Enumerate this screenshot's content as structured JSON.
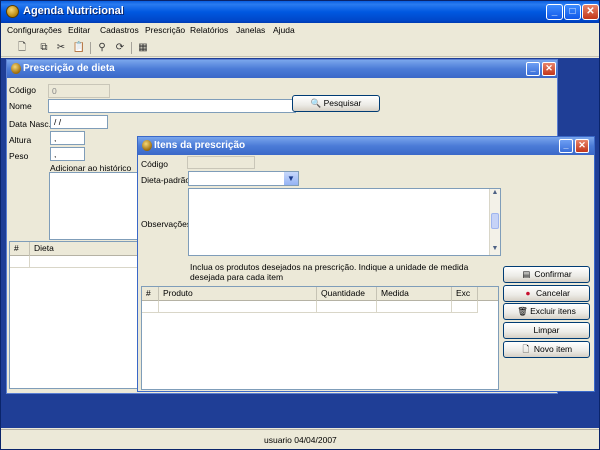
{
  "app": {
    "title": "Agenda Nutricional",
    "menu": [
      "Configurações",
      "Editar",
      "Cadastros",
      "Prescrição",
      "Relatórios",
      "Janelas",
      "Ajuda"
    ],
    "toolbar_icons": [
      "new-icon",
      "copy-icon",
      "cut-icon",
      "paste-icon",
      "find-icon",
      "refresh-icon",
      "calculator-icon"
    ],
    "status": "usuario  04/04/2007"
  },
  "prescricao": {
    "title": "Prescrição de dieta",
    "codigo_label": "Código",
    "codigo_value": "0",
    "nome_label": "Nome",
    "nome_value": "",
    "pesquisar_label": "Pesquisar",
    "data_nasc_label": "Data Nasc.",
    "data_nasc_value": " / /",
    "altura_label": "Altura",
    "altura_value": ",",
    "peso_label": "Peso",
    "peso_value": ",",
    "historico_label": "Adicionar ao histórico",
    "grid_headers": [
      "#",
      "Dieta"
    ]
  },
  "itens": {
    "title": "Itens da prescrição",
    "codigo_label": "Código",
    "dieta_padrao_label": "Dieta-padrão",
    "dieta_padrao_value": "",
    "observacoes_label": "Observações",
    "hint": "Inclua os produtos desejados na prescrição. Indique a unidade de medida desejada para cada item",
    "grid_headers": [
      "#",
      "Produto",
      "Quantidade",
      "Medida",
      "Exc"
    ],
    "buttons": {
      "confirmar": "Confirmar",
      "cancelar": "Cancelar",
      "excluir": "Excluir itens",
      "limpar": "Limpar",
      "novo": "Novo item"
    }
  },
  "colors": {
    "titlebar": "#0058E0",
    "workspace": "#1F3E96",
    "face": "#ECE9D8"
  }
}
